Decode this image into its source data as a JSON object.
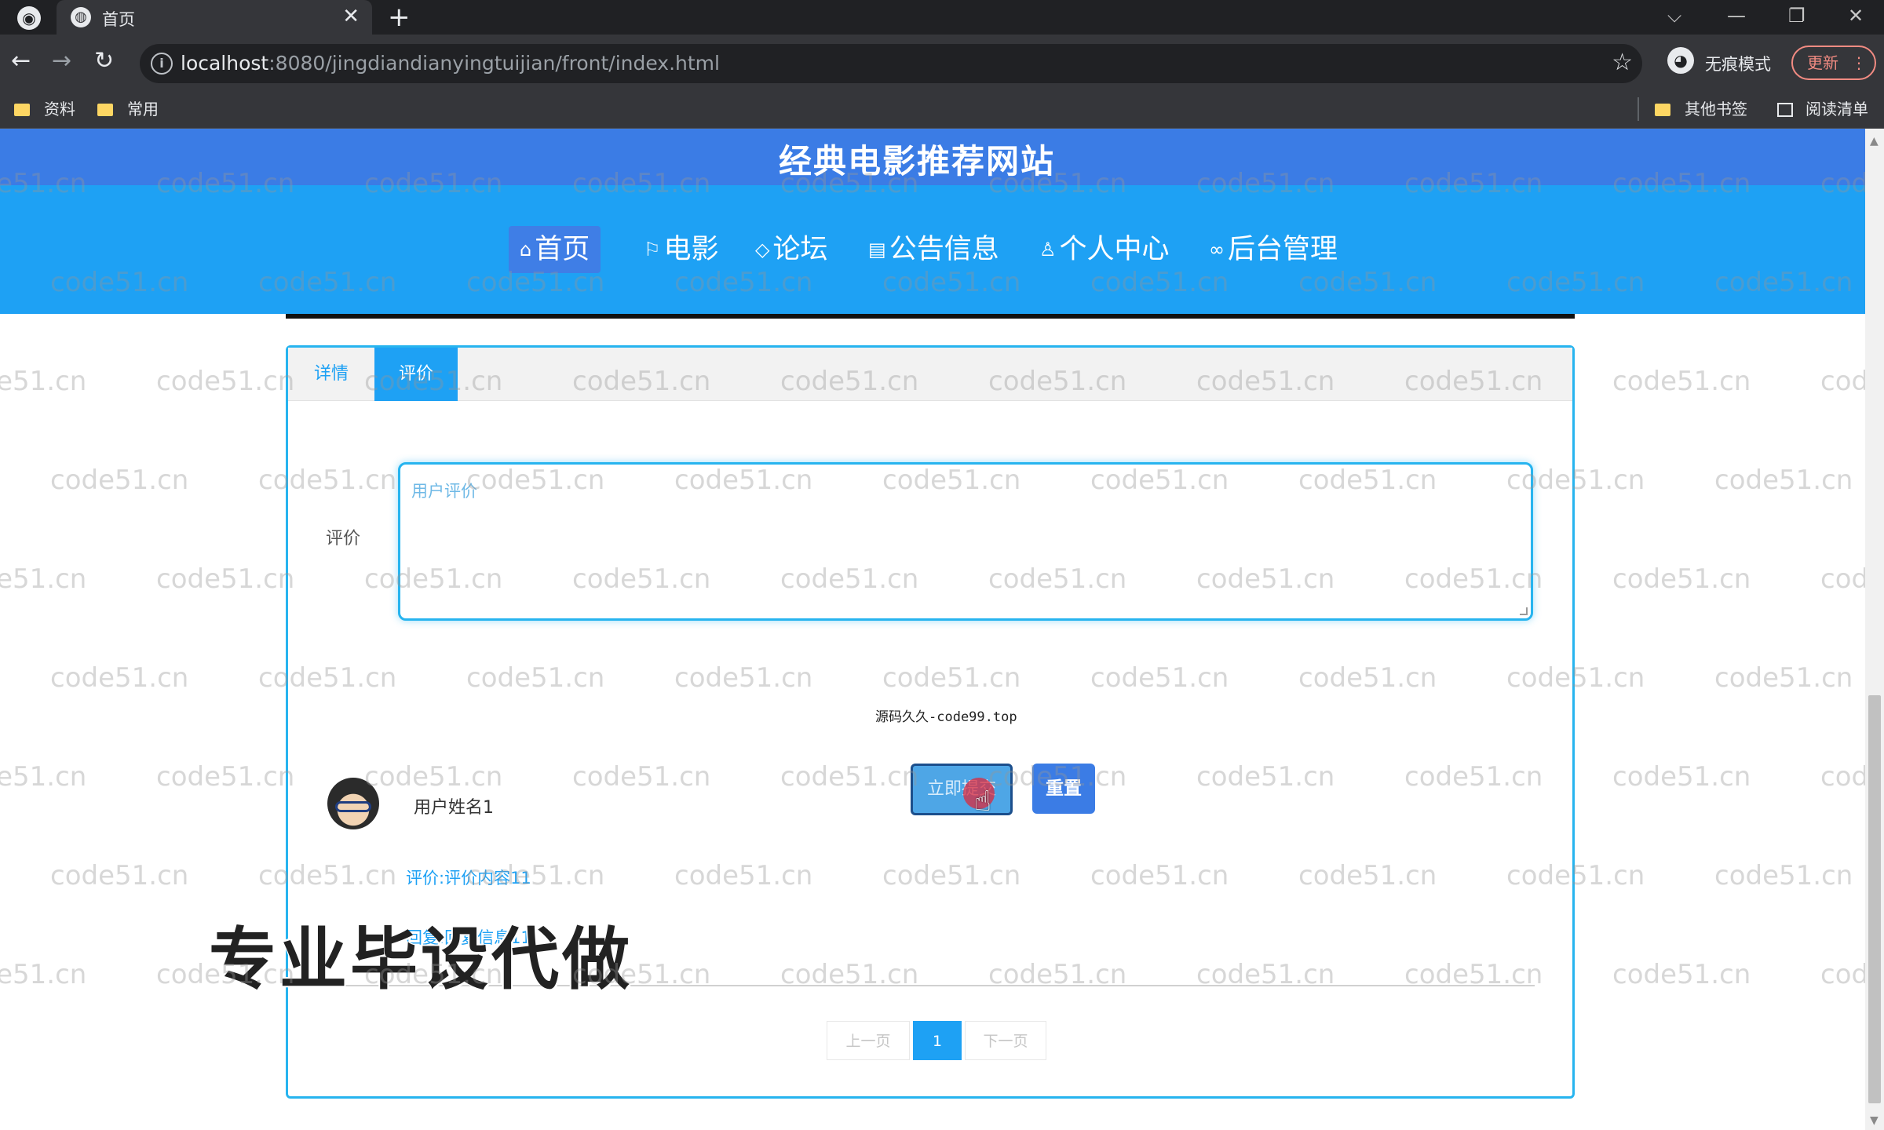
{
  "browser": {
    "tab_title": "首页",
    "new_tab": "+",
    "tab_close": "✕",
    "url_host": "localhost",
    "url_path": ":8080/jingdiandianyingtuijian/front/index.html",
    "incognito_label": "无痕模式",
    "update_label": "更新",
    "bookmarks": [
      "资料",
      "常用"
    ],
    "bookmarks_right": [
      "其他书签",
      "阅读清单"
    ],
    "window_controls": [
      "⌵",
      "—",
      "❐",
      "✕"
    ]
  },
  "site": {
    "title": "经典电影推荐网站",
    "nav": [
      {
        "icon": "⌂",
        "label": "首页",
        "active": true
      },
      {
        "icon": "⚐",
        "label": "电影"
      },
      {
        "icon": "◇",
        "label": "论坛"
      },
      {
        "icon": "▤",
        "label": "公告信息"
      },
      {
        "icon": "♙",
        "label": "个人中心"
      },
      {
        "icon": "∞",
        "label": "后台管理"
      }
    ]
  },
  "detail": {
    "tabs": [
      "详情",
      "评价"
    ],
    "active_tab": "评价",
    "form_label": "评价",
    "textarea_placeholder": "用户评价",
    "overlay_text": "源码久久-code99.top",
    "submit_label": "立即提交",
    "reset_label": "重置"
  },
  "comments": [
    {
      "user": "用户姓名1",
      "content": "评价:评价内容11",
      "reply": "回复:回复信息11"
    }
  ],
  "pager": {
    "prev": "上一页",
    "current": "1",
    "next": "下一页"
  },
  "promo_text": "专业毕设代做",
  "watermark_text": "code51.cn",
  "colors": {
    "header_blue": "#3b7ce5",
    "nav_blue": "#1ea1f4",
    "accent": "#27b4ef"
  }
}
